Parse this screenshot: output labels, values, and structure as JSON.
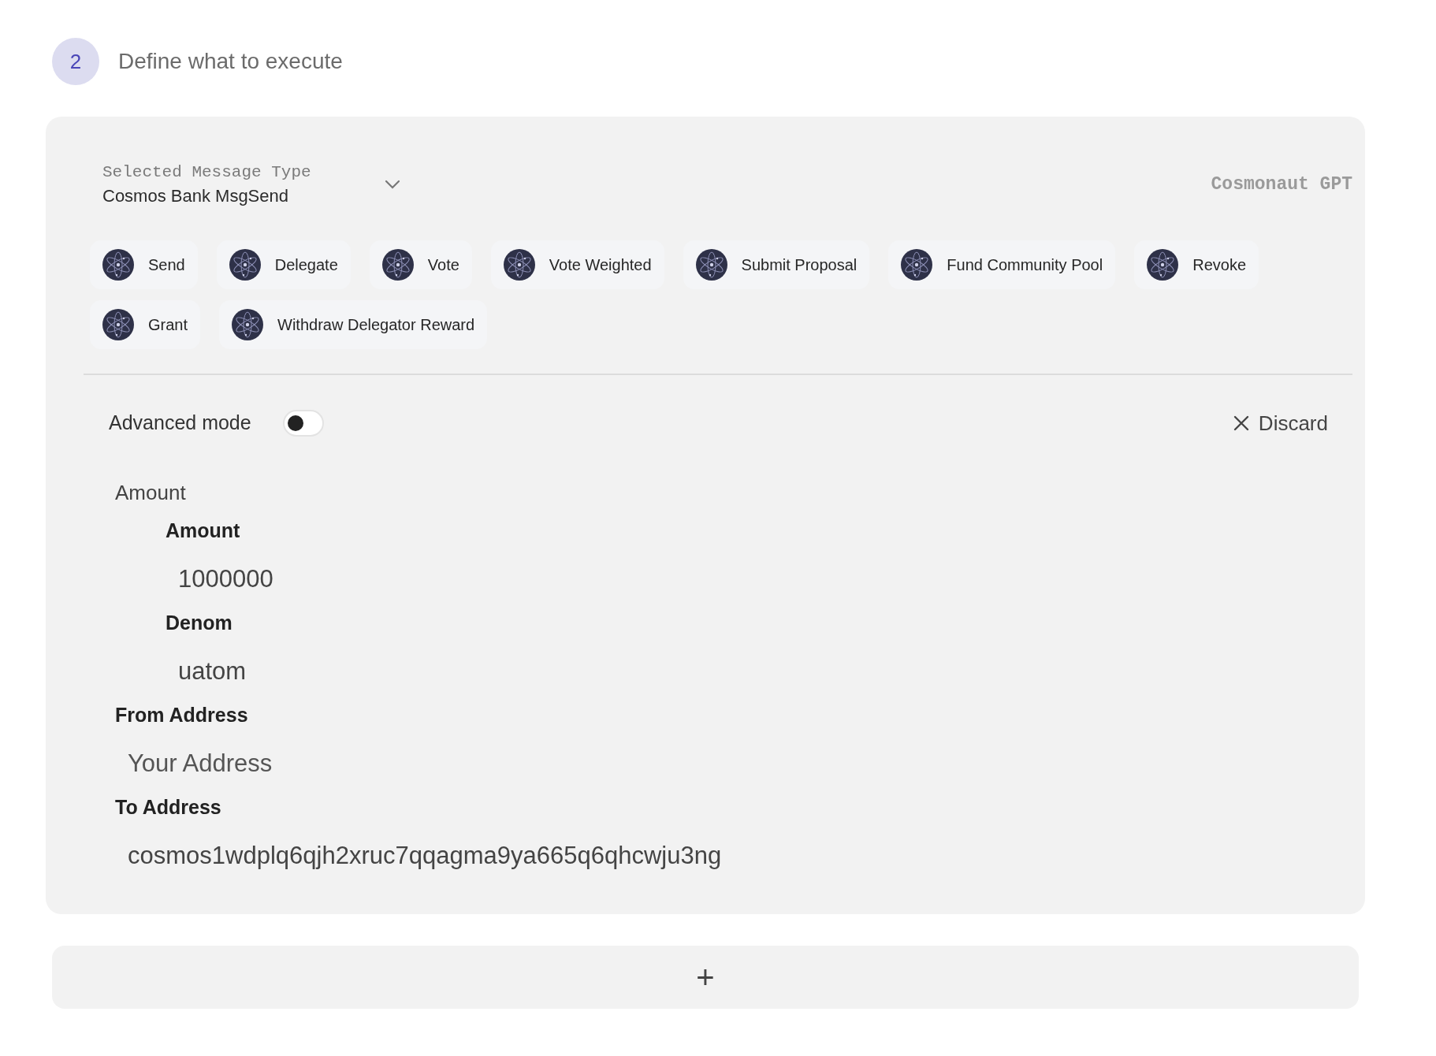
{
  "step": {
    "number": "2",
    "title": "Define what to execute"
  },
  "message_type": {
    "label": "Selected Message Type",
    "value": "Cosmos Bank MsgSend"
  },
  "assistant": "Cosmonaut GPT",
  "message_chips": [
    {
      "label": "Send"
    },
    {
      "label": "Delegate"
    },
    {
      "label": "Vote"
    },
    {
      "label": "Vote Weighted"
    },
    {
      "label": "Submit Proposal"
    },
    {
      "label": "Fund Community Pool"
    },
    {
      "label": "Revoke"
    },
    {
      "label": "Grant"
    },
    {
      "label": "Withdraw Delegator Reward"
    }
  ],
  "advanced_mode": {
    "label": "Advanced mode",
    "on": false
  },
  "discard": {
    "label": "Discard"
  },
  "form": [
    {
      "kind": "group",
      "label": "Amount",
      "children": [
        {
          "kind": "field",
          "label": "Amount",
          "value": "1000000"
        },
        {
          "kind": "field",
          "label": "Denom",
          "value": "uatom"
        }
      ]
    },
    {
      "kind": "field",
      "label": "From Address",
      "placeholder": "Your Address"
    },
    {
      "kind": "field",
      "label": "To Address",
      "value": "cosmos1wdplq6qjh2xruc7qqagma9ya665q6qhcwju3ng"
    }
  ],
  "add_button": {
    "label": "+"
  }
}
